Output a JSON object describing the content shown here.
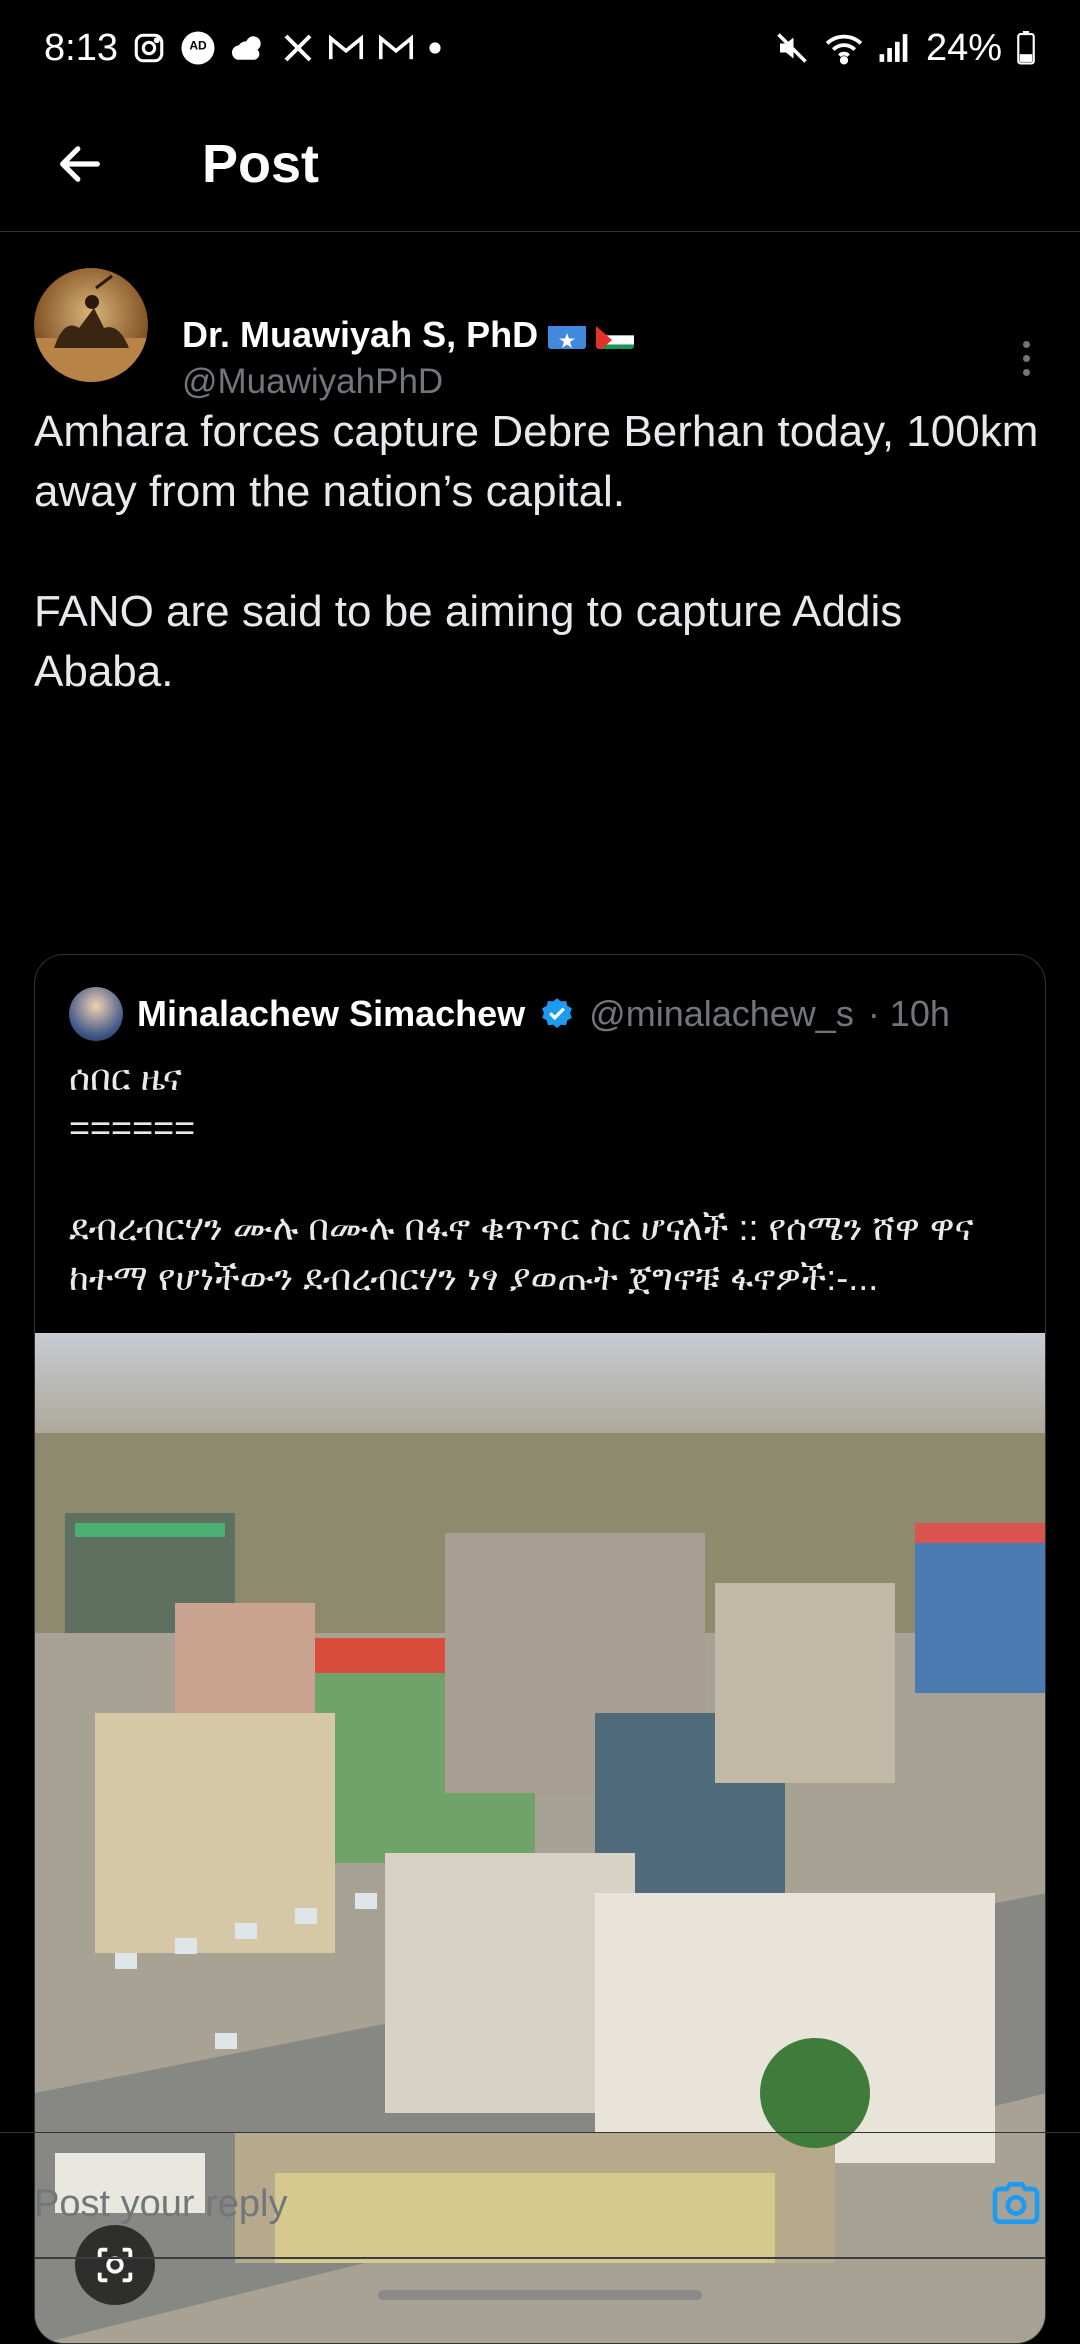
{
  "status_bar": {
    "time": "8:13",
    "battery": "24%",
    "icons": [
      "instagram-icon",
      "ad-blocker-icon",
      "weather-icon",
      "x-icon",
      "gmail-icon",
      "gmail-icon",
      "dot-icon",
      "mute-icon",
      "wifi-icon",
      "signal-icon",
      "battery-icon"
    ],
    "ad_blocker_label": "AD BLOCKER"
  },
  "header": {
    "title": "Post"
  },
  "post": {
    "author_name": "Dr. Muawiyah S, PhD",
    "author_handle": "@MuawiyahPhD",
    "text": "Amhara forces capture Debre Berhan today, 100km away from the nation’s capital.\n\nFANO are said to be aiming to capture Addis Ababa."
  },
  "quote": {
    "name": "Minalachew Simachew",
    "handle": "@minalachew_s",
    "time": "· 10h",
    "text": "ሰበር ዜና\n======\n\nደብረብርሃን ሙሉ በሙሉ በፋኖ ቁጥጥር  ስር ሆናለች :: የሰሜን ሸዋ  ዋና ከተማ የሆነችውን ደብረብርሃን ነፃ ያወጡት ጀግኖቹ ፋኖዎች:-..."
  },
  "reply": {
    "placeholder": "Post your reply"
  },
  "colors": {
    "background": "#000000",
    "accent": "#1d9bf0",
    "muted": "#71767b",
    "text": "#e7e9ea"
  }
}
